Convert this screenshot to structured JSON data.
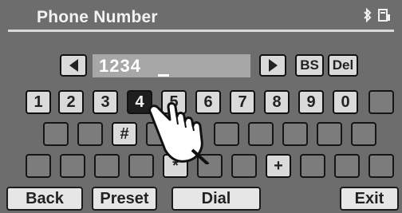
{
  "header": {
    "title": "Phone Number",
    "status_icons": [
      "bluetooth-icon",
      "phone-book-icon"
    ]
  },
  "entry": {
    "value": "1234",
    "backspace_label": "BS",
    "delete_label": "Del"
  },
  "keypad": {
    "digits": [
      "1",
      "2",
      "3",
      "4",
      "5",
      "6",
      "7",
      "8",
      "9",
      "0"
    ],
    "pressed_key": "4",
    "hash_label": "#",
    "star_label": "*",
    "plus_label": "+"
  },
  "bottom": {
    "back_label": "Back",
    "preset_label": "Preset",
    "dial_label": "Dial",
    "exit_label": "Exit"
  },
  "colors": {
    "background": "#6d6d6d",
    "key_light": "#dadada",
    "key_empty": "#7c7c7c",
    "key_pressed": "#1e1e1e",
    "display": "#a7a7a7"
  }
}
